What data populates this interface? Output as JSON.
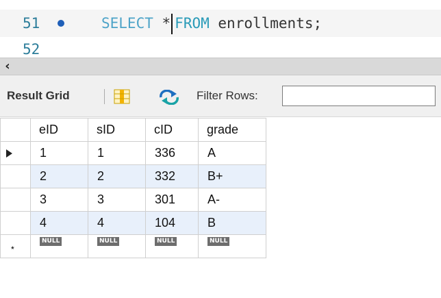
{
  "editor": {
    "current_line": {
      "number": "51",
      "tokens": {
        "kw1": "SELECT",
        "star": "*",
        "kw2": "FROM",
        "table": "enrollments;"
      }
    },
    "next_line": {
      "number": "52"
    }
  },
  "toolbar": {
    "result_grid_label": "Result Grid",
    "filter_label": "Filter Rows:",
    "filter_value": ""
  },
  "result": {
    "columns": [
      "eID",
      "sID",
      "cID",
      "grade"
    ],
    "rows": [
      [
        "1",
        "1",
        "336",
        "A"
      ],
      [
        "2",
        "2",
        "332",
        "B+"
      ],
      [
        "3",
        "3",
        "301",
        "A-"
      ],
      [
        "4",
        "4",
        "104",
        "B"
      ]
    ],
    "new_row": [
      "NULL",
      "NULL",
      "NULL",
      "NULL"
    ]
  },
  "colors": {
    "keyword": "#4da3c8",
    "row_alt": "#e8f0fb",
    "line_number": "#2c7d9a",
    "breakpoint_dot": "#1f5fb8"
  }
}
